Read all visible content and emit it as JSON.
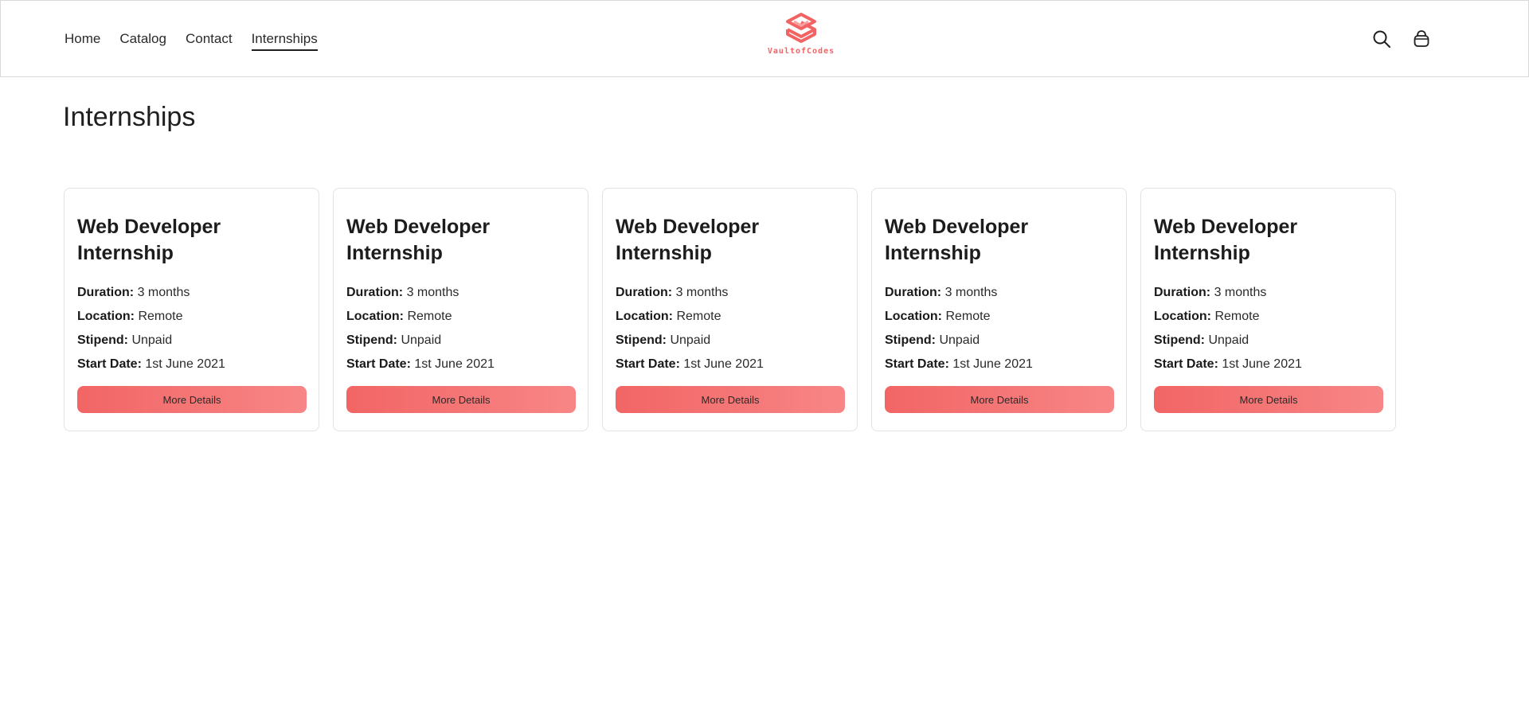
{
  "nav": {
    "home": "Home",
    "catalog": "Catalog",
    "contact": "Contact",
    "internships": "Internships"
  },
  "brand": {
    "name": "VaultofCodes",
    "accent_color": "#f26363"
  },
  "icons": {
    "search": "search-icon",
    "cart": "cart-icon"
  },
  "page": {
    "title": "Internships"
  },
  "labels": {
    "duration": "Duration:",
    "location": "Location:",
    "stipend": "Stipend:",
    "start_date": "Start Date:"
  },
  "cards": [
    {
      "title": "Web Developer Internship",
      "duration": "3 months",
      "location": "Remote",
      "stipend": "Unpaid",
      "start_date": "1st June 2021",
      "button": "More Details"
    },
    {
      "title": "Web Developer Internship",
      "duration": "3 months",
      "location": "Remote",
      "stipend": "Unpaid",
      "start_date": "1st June 2021",
      "button": "More Details"
    },
    {
      "title": "Web Developer Internship",
      "duration": "3 months",
      "location": "Remote",
      "stipend": "Unpaid",
      "start_date": "1st June 2021",
      "button": "More Details"
    },
    {
      "title": "Web Developer Internship",
      "duration": "3 months",
      "location": "Remote",
      "stipend": "Unpaid",
      "start_date": "1st June 2021",
      "button": "More Details"
    },
    {
      "title": "Web Developer Internship",
      "duration": "3 months",
      "location": "Remote",
      "stipend": "Unpaid",
      "start_date": "1st June 2021",
      "button": "More Details"
    }
  ]
}
